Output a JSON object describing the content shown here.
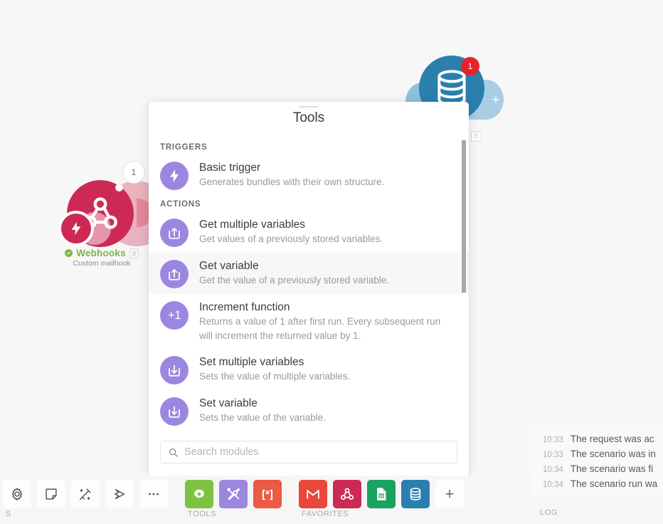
{
  "canvas": {
    "webhook_node": {
      "name": "Webhooks",
      "badge": "3",
      "sublabel": "Custom mailhook",
      "bubble_count": "1",
      "color": "#cc2a55",
      "icon": "webhook-icon"
    },
    "database_node": {
      "badge_count": "1",
      "side_badge": "5",
      "color": "#2b7fad",
      "icon": "database-icon",
      "add_icon": "plus-icon"
    }
  },
  "tools_panel": {
    "title": "Tools",
    "sections": [
      {
        "label": "TRIGGERS",
        "items": [
          {
            "name": "Basic trigger",
            "desc": "Generates bundles with their own structure.",
            "icon": "lightning-bolt-icon",
            "active": false
          }
        ]
      },
      {
        "label": "ACTIONS",
        "items": [
          {
            "name": "Get multiple variables",
            "desc": "Get values of a previously stored variables.",
            "icon": "upload-box-icon",
            "active": false
          },
          {
            "name": "Get variable",
            "desc": "Get the value of a previously stored variable.",
            "icon": "upload-box-icon",
            "active": true
          },
          {
            "name": "Increment function",
            "desc": "Returns a value of 1 after first run. Every subsequent run will increment the returned value by 1.",
            "icon": "plus-one-icon",
            "icon_text": "+1",
            "active": false
          },
          {
            "name": "Set multiple variables",
            "desc": "Sets the value of multiple variables.",
            "icon": "download-box-icon",
            "active": false
          },
          {
            "name": "Set variable",
            "desc": "Sets the value of the variable.",
            "icon": "download-box-icon",
            "active": false
          }
        ]
      }
    ],
    "search": {
      "placeholder": "Search modules",
      "value": "",
      "icon": "search-icon"
    },
    "accent_color": "#9b87e0"
  },
  "bottom_bar": {
    "left_caption": "S",
    "left_icons": [
      {
        "name": "gear-icon"
      },
      {
        "name": "note-icon"
      },
      {
        "name": "magic-wand-icon"
      },
      {
        "name": "flow-icon"
      },
      {
        "name": "more-icon"
      }
    ],
    "tools_caption": "TOOLS",
    "tools_icons": [
      {
        "name": "flow-control-gear-icon",
        "color": "#7dc242"
      },
      {
        "name": "tools-icon",
        "color": "#9b87e0"
      },
      {
        "name": "array-tools-icon",
        "color": "#ec5b43",
        "label": "[*]"
      }
    ],
    "favorites_caption": "FAVORITES",
    "favorites_icons": [
      {
        "name": "gmail-icon",
        "color": "#e8483a"
      },
      {
        "name": "webhook-icon",
        "color": "#cc2a55"
      },
      {
        "name": "google-sheets-icon",
        "color": "#1aa260"
      },
      {
        "name": "database-icon",
        "color": "#2b7fad"
      }
    ],
    "add_label": "+"
  },
  "log": {
    "caption": "LOG",
    "rows": [
      {
        "time": "10:33",
        "message": "The request was ac"
      },
      {
        "time": "10:33",
        "message": "The scenario was in"
      },
      {
        "time": "10:34",
        "message": "The scenario was fi"
      },
      {
        "time": "10:34",
        "message": "The scenario run wa"
      }
    ]
  }
}
